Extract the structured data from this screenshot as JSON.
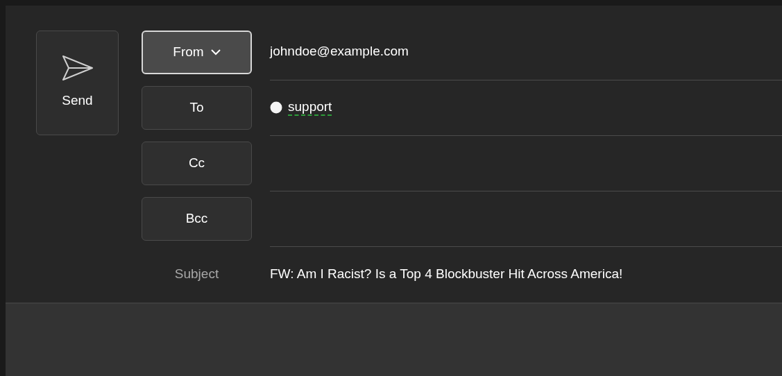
{
  "send": {
    "label": "Send"
  },
  "rows": [
    {
      "kind": "button",
      "label": "From",
      "dropdown": true,
      "highlighted": true,
      "value": "johndoe@example.com"
    },
    {
      "kind": "button",
      "label": "To",
      "dropdown": false,
      "highlighted": false,
      "recipients": [
        {
          "name": "support",
          "misspelled": true
        }
      ]
    },
    {
      "kind": "button",
      "label": "Cc",
      "dropdown": false,
      "highlighted": false
    },
    {
      "kind": "button",
      "label": "Bcc",
      "dropdown": false,
      "highlighted": false
    },
    {
      "kind": "label",
      "label": "Subject",
      "value": "FW: Am I Racist? Is a Top 4 Blockbuster Hit Across America!"
    }
  ]
}
